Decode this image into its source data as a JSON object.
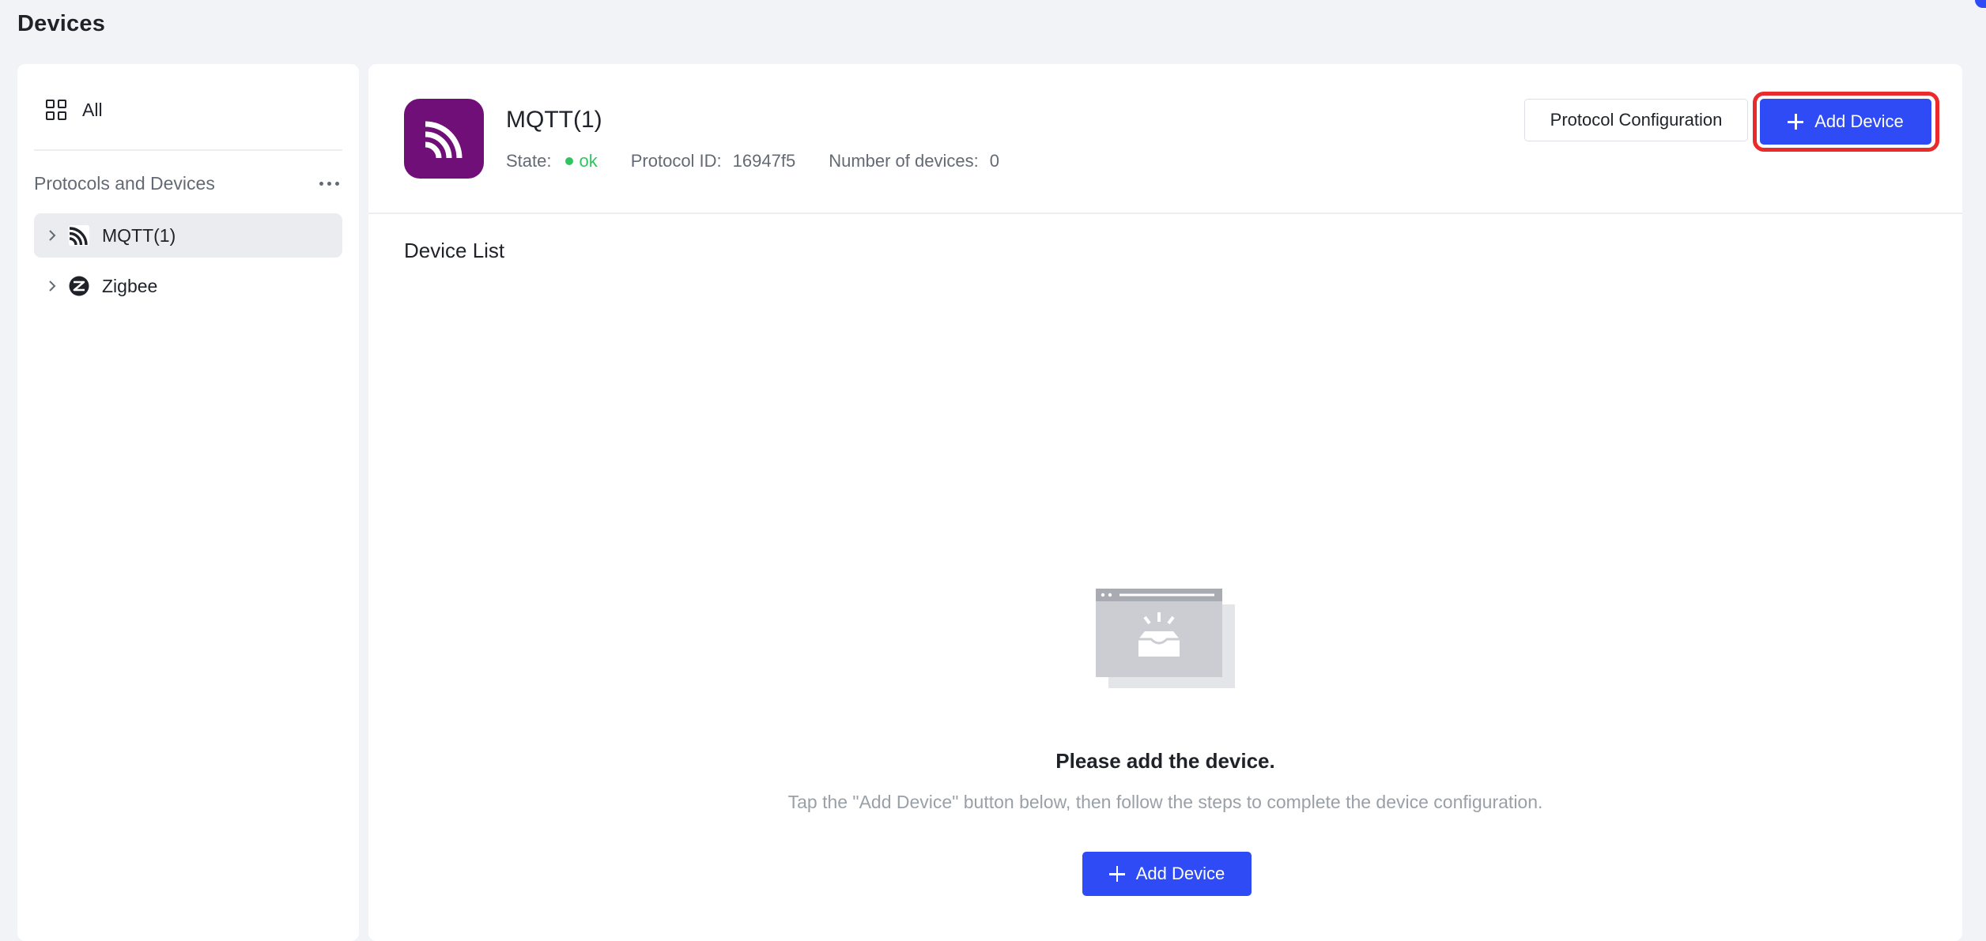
{
  "page": {
    "title": "Devices"
  },
  "sidebar": {
    "all_label": "All",
    "section_label": "Protocols and Devices",
    "items": [
      {
        "label": "MQTT(1)",
        "icon": "mqtt-icon",
        "selected": true
      },
      {
        "label": "Zigbee",
        "icon": "zigbee-icon",
        "selected": false
      }
    ]
  },
  "protocol": {
    "name": "MQTT(1)",
    "state_label": "State:",
    "state_value": "ok",
    "id_label": "Protocol ID:",
    "id_value": "16947f5",
    "count_label": "Number of devices:",
    "count_value": "0",
    "logo_color": "#6f0f77"
  },
  "toolbar": {
    "protocol_config_label": "Protocol Configuration",
    "add_device_label": "Add Device"
  },
  "device_list": {
    "title": "Device List",
    "empty_title": "Please add the device.",
    "empty_desc": "Tap the \"Add Device\" button below, then follow the steps to complete the device configuration.",
    "add_device_label": "Add Device"
  },
  "colors": {
    "accent": "#2e4bf5",
    "status_ok": "#2ec55f",
    "highlight": "#ea2b2b"
  }
}
